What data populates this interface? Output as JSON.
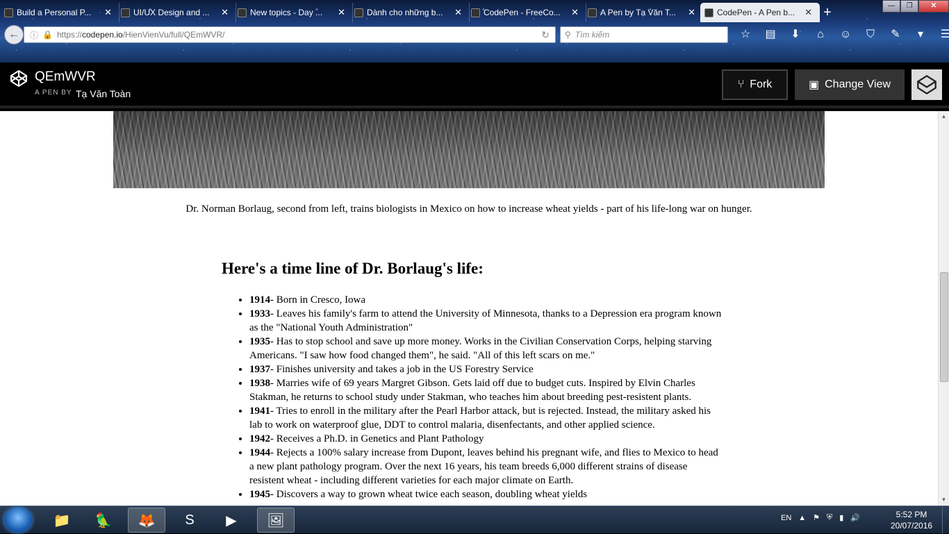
{
  "browser": {
    "tabs": [
      {
        "label": "Build a Personal P...",
        "active": false
      },
      {
        "label": "UI/UX Design and ...",
        "active": false
      },
      {
        "label": "New topics - Day ...",
        "active": false
      },
      {
        "label": "Dành cho những b...",
        "active": false
      },
      {
        "label": "CodePen - FreeCo...",
        "active": false
      },
      {
        "label": "A Pen by Tạ Văn T...",
        "active": false
      },
      {
        "label": "CodePen - A Pen b...",
        "active": true
      }
    ],
    "url_prefix": "https://",
    "url_domain": "codepen.io",
    "url_path": "/HienVienVu/full/QEmWVR/",
    "search_placeholder": "Tìm kiếm"
  },
  "codepen": {
    "title": "QEmWVR",
    "by_label": "A PEN BY",
    "author": "Tạ Văn Toàn",
    "fork_label": "Fork",
    "change_view_label": "Change View"
  },
  "page": {
    "caption": "Dr. Norman Borlaug, second from left, trains biologists in Mexico on how to increase wheat yields - part of his life-long war on hunger.",
    "heading": "Here's a time line of Dr. Borlaug's life:",
    "timeline": [
      {
        "year": "1914",
        "text": "- Born in Cresco, Iowa"
      },
      {
        "year": "1933",
        "text": "- Leaves his family's farm to attend the University of Minnesota, thanks to a Depression era program known as the \"National Youth Administration\""
      },
      {
        "year": "1935",
        "text": "- Has to stop school and save up more money. Works in the Civilian Conservation Corps, helping starving Americans. \"I saw how food changed them\", he said. \"All of this left scars on me.\""
      },
      {
        "year": "1937",
        "text": "- Finishes university and takes a job in the US Forestry Service"
      },
      {
        "year": "1938",
        "text": "- Marries wife of 69 years Margret Gibson. Gets laid off due to budget cuts. Inspired by Elvin Charles Stakman, he returns to school study under Stakman, who teaches him about breeding pest-resistent plants."
      },
      {
        "year": "1941",
        "text": "- Tries to enroll in the military after the Pearl Harbor attack, but is rejected. Instead, the military asked his lab to work on waterproof glue, DDT to control malaria, disenfectants, and other applied science."
      },
      {
        "year": "1942",
        "text": "- Receives a Ph.D. in Genetics and Plant Pathology"
      },
      {
        "year": "1944",
        "text": "- Rejects a 100% salary increase from Dupont, leaves behind his pregnant wife, and flies to Mexico to head a new plant pathology program. Over the next 16 years, his team breeds 6,000 different strains of disease resistent wheat - including different varieties for each major climate on Earth."
      },
      {
        "year": "1945",
        "text": "- Discovers a way to grown wheat twice each season, doubling wheat yields"
      }
    ]
  },
  "taskbar": {
    "language": "EN",
    "time": "5:52 PM",
    "date": "20/07/2016"
  },
  "colors": {
    "codepen_bar": "#000000",
    "page_bg": "#ffffff",
    "active_tab": "#e9edf2"
  }
}
